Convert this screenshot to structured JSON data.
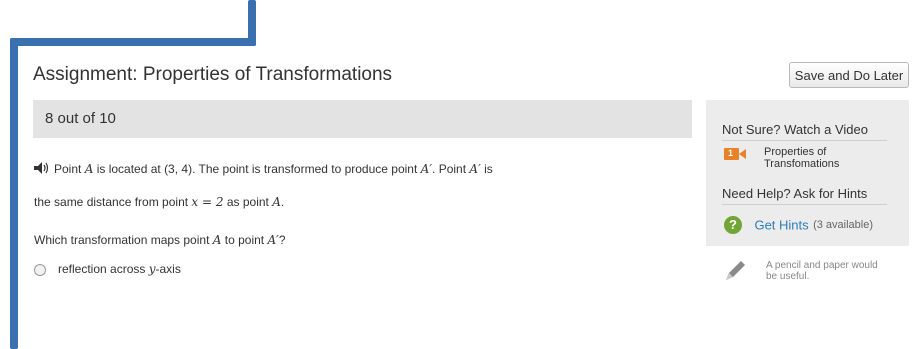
{
  "assignment": {
    "title": "Assignment: Properties of Transformations",
    "save_button": "Save and Do Later",
    "progress": "8 out of 10"
  },
  "question": {
    "line1_a": "Point ",
    "line1_var1": "A",
    "line1_b": " is located at (3, 4). The point is transformed to produce point ",
    "line1_var2": "A′",
    "line1_c": ". Point ",
    "line1_var3": "A′",
    "line1_d": " is",
    "line2_a": "the same distance from point ",
    "line2_math": "x = 2",
    "line2_b": " as point ",
    "line2_var": "A",
    "line2_c": ".",
    "line3_a": "Which transformation maps point ",
    "line3_var1": "A",
    "line3_b": " to point ",
    "line3_var2": "A′",
    "line3_c": "?",
    "answer_a": "reflection across ",
    "answer_var": "y",
    "answer_b": "-axis"
  },
  "sidebar": {
    "video_heading": "Not Sure? Watch a Video",
    "video_number": "1",
    "video_label": "Properties of Transfomations",
    "hints_heading": "Need Help? Ask for Hints",
    "hint_link": "Get Hints",
    "hint_count": "(3 available)"
  },
  "pencil_note": "A pencil and paper would be useful.",
  "colors": {
    "frame": "#3a6fb0",
    "video_badge": "#e8822a",
    "hint_icon": "#72a536",
    "link": "#2a7fb8"
  }
}
